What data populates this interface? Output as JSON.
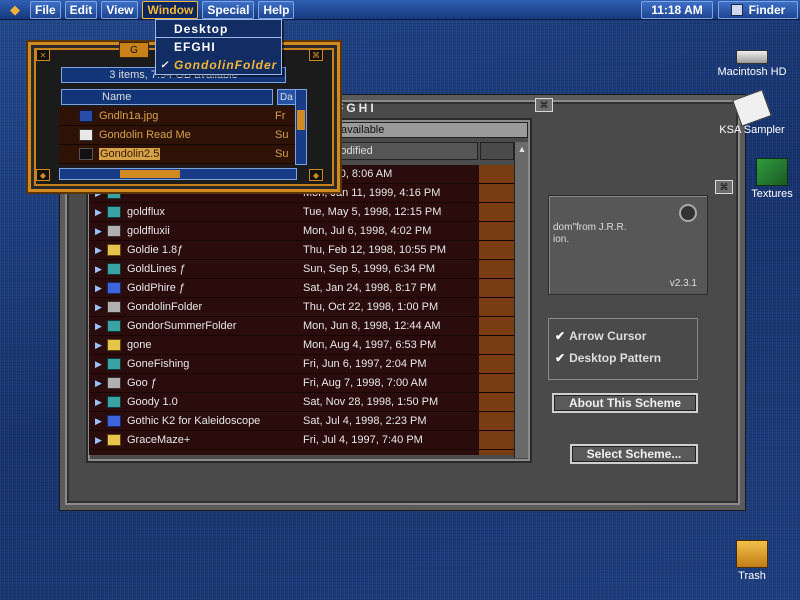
{
  "menubar": {
    "menus": [
      "File",
      "Edit",
      "View",
      "Window",
      "Special",
      "Help"
    ],
    "active_menu": "Window",
    "clock": "11:18 AM",
    "app_name": "Finder"
  },
  "window_menu": {
    "items": [
      "Desktop",
      "EFGHI",
      "GondolinFolder"
    ],
    "checked_item": "GondolinFolder"
  },
  "front_window": {
    "tab_label": "G",
    "status": "3 items, 7.94 GB available",
    "columns": [
      "Name",
      "Da"
    ],
    "items": [
      {
        "name": "Gndln1a.jpg",
        "date": "Fr",
        "icon": "image-file-icon"
      },
      {
        "name": "Gondolin Read Me",
        "date": "Su",
        "icon": "document-icon"
      },
      {
        "name": "Gondolin2.5",
        "date": "Su",
        "icon": "application-icon"
      }
    ],
    "selected_item": "Gondolin2.5"
  },
  "back_window": {
    "title": "EFGHI",
    "status": "GB available",
    "column_header": "e Modified",
    "rows": [
      {
        "name": "",
        "date": "24, 2010, 8:06 AM",
        "icon": "folder-icon"
      },
      {
        "name": "",
        "date": "Mon, Jan 11, 1999, 4:16 PM",
        "icon": "folder-icon"
      },
      {
        "name": "goldflux",
        "date": "Tue, May 5, 1998, 12:15 PM",
        "icon": "folder-icon"
      },
      {
        "name": "goldfluxii",
        "date": "Mon, Jul 6, 1998, 4:02 PM",
        "icon": "folder-icon"
      },
      {
        "name": "Goldie 1.8ƒ",
        "date": "Thu, Feb 12, 1998, 10:55 PM",
        "icon": "folder-icon"
      },
      {
        "name": "GoldLines ƒ",
        "date": "Sun, Sep 5, 1999, 6:34 PM",
        "icon": "folder-icon"
      },
      {
        "name": "GoldPhire ƒ",
        "date": "Sat, Jan 24, 1998, 8:17 PM",
        "icon": "folder-icon"
      },
      {
        "name": "GondolinFolder",
        "date": "Thu, Oct 22, 1998, 1:00 PM",
        "icon": "folder-icon"
      },
      {
        "name": "GondorSummerFolder",
        "date": "Mon, Jun 8, 1998, 12:44 AM",
        "icon": "folder-icon"
      },
      {
        "name": "gone",
        "date": "Mon, Aug 4, 1997, 6:53 PM",
        "icon": "folder-icon"
      },
      {
        "name": "GoneFishing",
        "date": "Fri, Jun 6, 1997, 2:04 PM",
        "icon": "folder-icon"
      },
      {
        "name": "Goo ƒ",
        "date": "Fri, Aug 7, 1998, 7:00 AM",
        "icon": "folder-icon"
      },
      {
        "name": "Goody 1.0",
        "date": "Sat, Nov 28, 1998, 1:50 PM",
        "icon": "folder-icon"
      },
      {
        "name": "Gothic K2 for Kaleidoscope",
        "date": "Sat, Jul 4, 1998, 2:23 PM",
        "icon": "folder-icon"
      },
      {
        "name": "GraceMaze+",
        "date": "Fri, Jul 4, 1997, 7:40 PM",
        "icon": "folder-icon"
      }
    ]
  },
  "scheme_panel": {
    "description_line1": "dom\"from J.R.R.",
    "description_line2": "ion.",
    "version": "v2.3.1",
    "options": [
      "Arrow Cursor",
      "Desktop Pattern"
    ],
    "about_button": "About This Scheme",
    "select_button": "Select Scheme..."
  },
  "desktop_icons": [
    {
      "label": "Macintosh HD",
      "icon": "hard-disk-icon"
    },
    {
      "label": "KSA Sampler",
      "icon": "ksa-sampler-icon"
    },
    {
      "label": "Textures",
      "icon": "textures-folder-icon"
    },
    {
      "label": "Trash",
      "icon": "trash-icon"
    }
  ]
}
